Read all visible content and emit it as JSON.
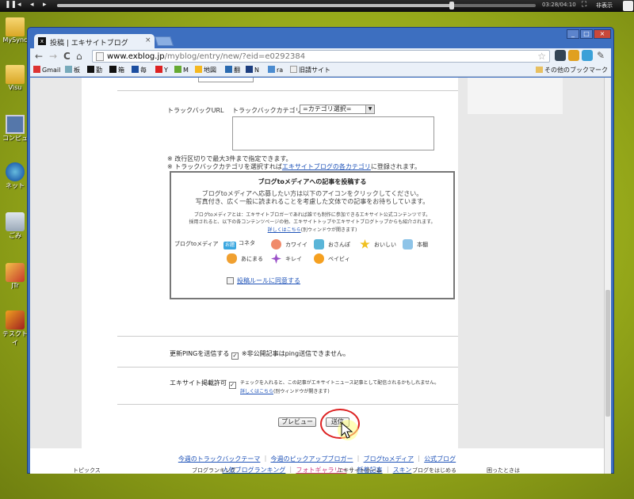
{
  "player": {
    "controls": [
      "❚❚",
      "◂",
      "◂",
      "▸"
    ],
    "time": "03:28/04:10",
    "fullscreen_icon": "⛶",
    "hide_label": "非表示",
    "progress": 0.825
  },
  "desktop": {
    "icons": [
      {
        "label": "MySync",
        "kind": "folder"
      },
      {
        "label": "Visu",
        "kind": "folder"
      },
      {
        "label": "コンピュ",
        "kind": "computer"
      },
      {
        "label": "ネット",
        "kind": "globe"
      },
      {
        "label": "ごみ",
        "kind": "trash"
      },
      {
        "label": "JTr",
        "kind": "app"
      },
      {
        "label": "テスクト\nイ",
        "kind": "app2"
      }
    ]
  },
  "browser": {
    "tab_title": "投稿 | エキサイトブログ",
    "tab_favicon": "x",
    "tab_close": "×",
    "window_buttons": [
      "_",
      "□",
      "×"
    ],
    "nav": {
      "back": "←",
      "forward": "→",
      "reload": "C",
      "home": "⌂"
    },
    "url": {
      "host": "www.exblog.jp",
      "path": "/myblog/entry/new/?eid=e0292384"
    },
    "star": "☆",
    "extensions": [
      "ext1",
      "ext2",
      "ext3",
      "ext4",
      "wrench"
    ],
    "bookmarks": [
      "Gmail",
      "板",
      "勤",
      "箱",
      "毎",
      "Y",
      "M",
      "地図",
      "翻",
      "N",
      "ra",
      "旧請サイト"
    ],
    "other_bookmarks": "その他のブックマーク"
  },
  "form": {
    "trackback_label": "トラックバックURL",
    "trackback_cat_label": "トラックバックカテゴリ：",
    "trackback_cat_value": "=カテゴリ選択=",
    "note1": "※ 改行区切りで最大3件まで指定できます。",
    "note2_prefix": "※ トラックバックカテゴリを選択すれば",
    "note2_link": "エキサイトブログの各カテゴリ",
    "note2_suffix": "に登録されます。",
    "post_title": "ブログtoメディアへの記事を投稿する",
    "post_desc1": "ブログtoメディアへ応募したい方は以下のアイコンをクリックしてください。",
    "post_desc2": "写真付き、広く一般に読まれることを考慮した文体での記事をお待ちしています。",
    "post_small1": "ブログtoメディアとは：エキサイトブロガーであれば誰でも制作に参加できるエキサイト公式コンテンツです。",
    "post_small2": "採用されると、以下の各コンテンツページの他、エキサイトトップやエキサイトブログトップからも紹介されます。",
    "post_more_link": "詳しくはこちら",
    "post_more_suffix": "(別ウィンドウが開きます)",
    "media_label": "ブログtoメディア",
    "categories": [
      {
        "label": "コネタ",
        "badge": "お題",
        "color": "#3aa7e0"
      },
      {
        "label": "カワイイ",
        "color": "#f08a6a"
      },
      {
        "label": "おさんぽ",
        "color": "#5ab5d8"
      },
      {
        "label": "おいしい",
        "color": "#f0c020"
      },
      {
        "label": "本棚",
        "color": "#8ec4e8"
      },
      {
        "label": "あにまる",
        "color": "#f0a030"
      },
      {
        "label": "キレイ",
        "color": "#9a50c8"
      },
      {
        "label": "ベイビィ",
        "color": "#f5a020"
      }
    ],
    "agree_label": "投稿ルールに同意する",
    "ping_label": "更新PINGを送信する",
    "ping_note": "※非公開記事はping送信できません。",
    "excite_label": "エキサイト掲載許可",
    "excite_note": "チェックを入れると、この記事がエキサイトニュース記事として配信されるかもしれません。",
    "excite_more_link": "詳しくはこちら",
    "excite_more_suffix": "(別ウィンドウが開きます)",
    "preview_button": "プレビュー",
    "submit_button": "送信"
  },
  "footer": {
    "links1": [
      "今週のトラックバックテーマ",
      "今週のピックアップブロガー",
      "ブログtoメディア",
      "公式ブログ"
    ],
    "links2": [
      "人気ブログランキング",
      "フォトギャラリー",
      "新着記事",
      "スキン"
    ],
    "bottom": [
      "トピックス",
      "ブログランキング",
      "エキサイトホーム",
      "ブログをはじめる",
      "困ったときは"
    ]
  },
  "colors": {
    "accent": "#1f53b8",
    "window": "#3d6fc0",
    "highlight": "#d22222"
  }
}
